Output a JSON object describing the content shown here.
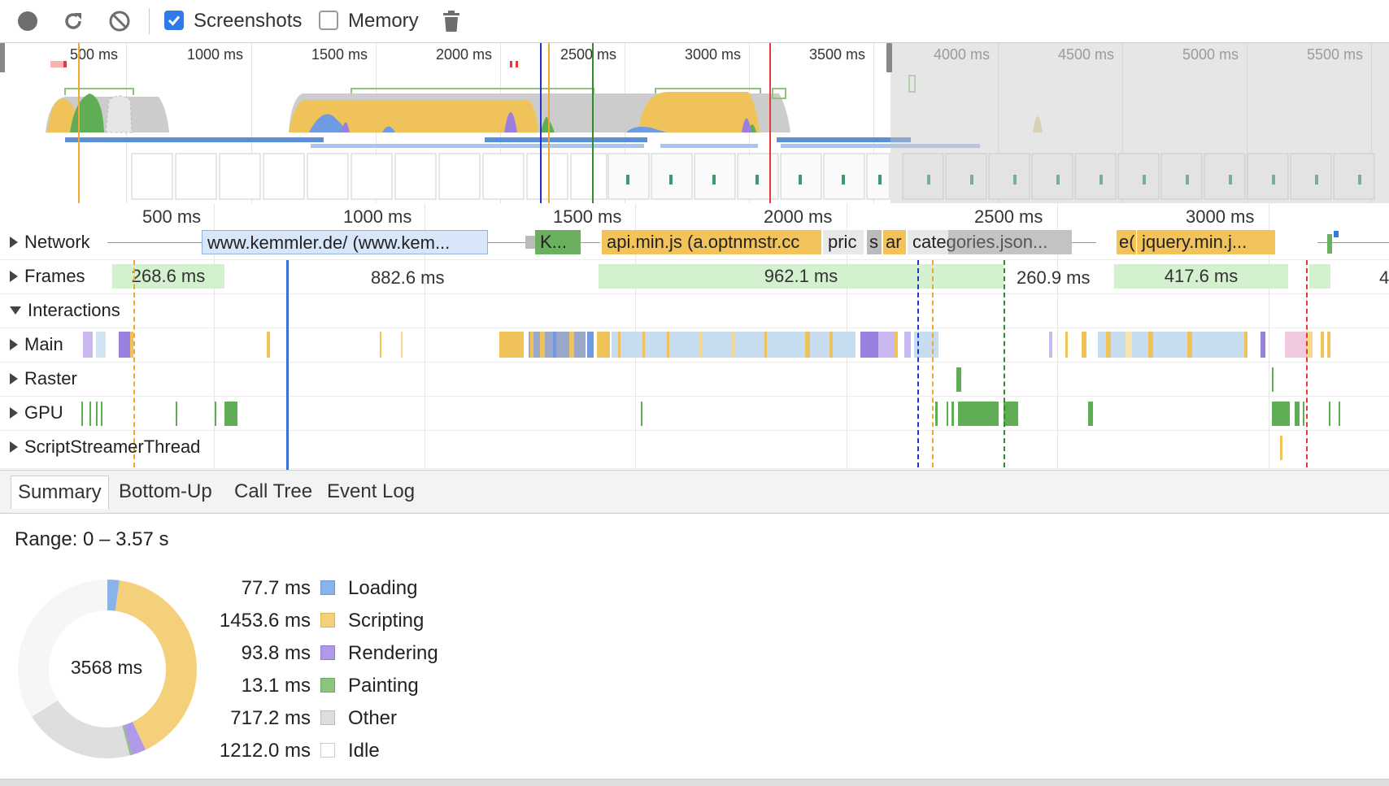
{
  "toolbar": {
    "record_icon": "record-icon",
    "reload_icon": "reload-icon",
    "clear_icon": "clear-icon",
    "screenshots_label": "Screenshots",
    "screenshots_checked": true,
    "memory_label": "Memory",
    "memory_checked": false,
    "trash_icon": "trash-icon"
  },
  "overview": {
    "ticks": [
      "500 ms",
      "1000 ms",
      "1500 ms",
      "2000 ms",
      "2500 ms",
      "3000 ms",
      "3500 ms",
      "4000 ms",
      "4500 ms",
      "5000 ms",
      "5500 ms"
    ]
  },
  "ruler": {
    "ticks": [
      "500 ms",
      "1000 ms",
      "1500 ms",
      "2000 ms",
      "2500 ms",
      "3000 ms"
    ]
  },
  "tracks": {
    "network": "Network",
    "frames": "Frames",
    "interactions": "Interactions",
    "main": "Main",
    "raster": "Raster",
    "gpu": "GPU",
    "script_streamer": "ScriptStreamerThread"
  },
  "network_requests": [
    "www.kemmler.de/ (www.kem...",
    "K...",
    "api.min.js (a.optnmstr.cc",
    "pric",
    "s",
    "ar",
    "categories.json...",
    "e(",
    "jquery.min.j..."
  ],
  "frames": [
    "268.6 ms",
    "882.6 ms",
    "962.1 ms",
    "260.9 ms",
    "417.6 ms",
    "4"
  ],
  "tabs": [
    "Summary",
    "Bottom-Up",
    "Call Tree",
    "Event Log"
  ],
  "summary": {
    "range": "Range: 0 – 3.57 s",
    "total": "3568 ms",
    "items": [
      {
        "value": "77.7 ms",
        "name": "Loading",
        "color": "#8ab4e8",
        "border": "#6a9bd8"
      },
      {
        "value": "1453.6 ms",
        "name": "Scripting",
        "color": "#f5d07a",
        "border": "#e0b550"
      },
      {
        "value": "93.8 ms",
        "name": "Rendering",
        "color": "#b09ae8",
        "border": "#9378d8"
      },
      {
        "value": "13.1 ms",
        "name": "Painting",
        "color": "#8cc47e",
        "border": "#6aa85a"
      },
      {
        "value": "717.2 ms",
        "name": "Other",
        "color": "#dddddd",
        "border": "#bbbbbb"
      },
      {
        "value": "1212.0 ms",
        "name": "Idle",
        "color": "#ffffff",
        "border": "#cccccc"
      }
    ]
  }
}
